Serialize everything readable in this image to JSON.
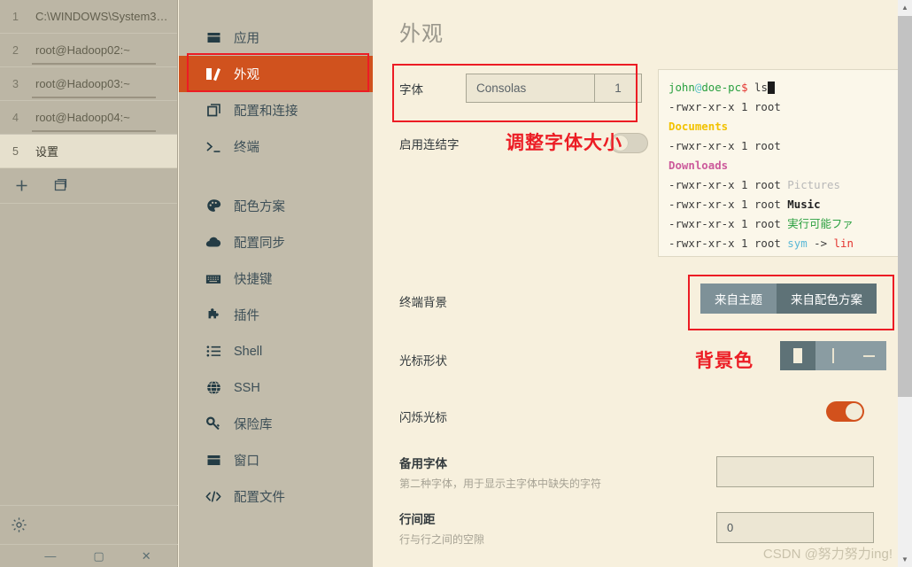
{
  "tabs": [
    {
      "num": "1",
      "label": "C:\\WINDOWS\\System3…",
      "active": false,
      "underline": false
    },
    {
      "num": "2",
      "label": "root@Hadoop02:~",
      "active": false,
      "underline": true
    },
    {
      "num": "3",
      "label": "root@Hadoop03:~",
      "active": false,
      "underline": true
    },
    {
      "num": "4",
      "label": "root@Hadoop04:~",
      "active": false,
      "underline": true
    },
    {
      "num": "5",
      "label": "设置",
      "active": true,
      "underline": false
    }
  ],
  "tab_actions": {
    "new_tab_icon": "plus-icon",
    "split_icon": "window-copy-icon"
  },
  "rail_bottom": {
    "settings_icon": "gear-icon"
  },
  "window_controls": {
    "minimize": "—",
    "maximize": "▢",
    "close": "✕"
  },
  "settings_nav": {
    "items": [
      {
        "label": "应用",
        "icon": "window-icon",
        "selected": false
      },
      {
        "label": "外观",
        "icon": "appearance-icon",
        "selected": true
      },
      {
        "label": "配置和连接",
        "icon": "profiles-icon",
        "selected": false
      },
      {
        "label": "终端",
        "icon": "terminal-prompt-icon",
        "selected": false
      },
      {
        "label": "配色方案",
        "icon": "palette-icon",
        "selected": false
      },
      {
        "label": "配置同步",
        "icon": "cloud-icon",
        "selected": false
      },
      {
        "label": "快捷键",
        "icon": "keyboard-icon",
        "selected": false
      },
      {
        "label": "插件",
        "icon": "puzzle-icon",
        "selected": false
      },
      {
        "label": "Shell",
        "icon": "list-icon",
        "selected": false
      },
      {
        "label": "SSH",
        "icon": "globe-icon",
        "selected": false
      },
      {
        "label": "保险库",
        "icon": "key-icon",
        "selected": false
      },
      {
        "label": "窗口",
        "icon": "window-icon",
        "selected": false
      },
      {
        "label": "配置文件",
        "icon": "code-icon",
        "selected": false
      }
    ]
  },
  "main": {
    "title": "外观",
    "font_row": {
      "label": "字体",
      "font_name": "Consolas",
      "font_name_placeholder": "",
      "font_size": "1",
      "font_size_placeholder": ""
    },
    "ligature_row": {
      "label": "启用连结字",
      "enabled": false
    },
    "terminal_background_row": {
      "label": "终端背景",
      "options": [
        {
          "label": "来自主题",
          "active": false
        },
        {
          "label": "来自配色方案",
          "active": true
        }
      ]
    },
    "cursor_shape_row": {
      "label": "光标形状",
      "options": [
        {
          "name": "block",
          "active": true
        },
        {
          "name": "beam",
          "active": false
        },
        {
          "name": "underline",
          "active": false
        }
      ]
    },
    "blink_cursor_row": {
      "label": "闪烁光标",
      "enabled": true
    },
    "fallback_font_row": {
      "label": "备用字体",
      "sublabel": "第二种字体，用于显示主字体中缺失的字符",
      "value": "",
      "placeholder": ""
    },
    "line_height_row": {
      "label": "行间距",
      "sublabel": "行与行之间的空隙",
      "value": "0",
      "placeholder": ""
    }
  },
  "terminal_preview": {
    "prompt": {
      "user": "john",
      "at": "@",
      "host": "doe-pc",
      "sigil": "$",
      "command": "ls"
    },
    "lines": [
      {
        "perm": "-rwxr-xr-x 1 root",
        "name": "",
        "name_class": ""
      },
      {
        "perm": "",
        "name": "Documents",
        "name_class": "tok-yellow"
      },
      {
        "perm": "-rwxr-xr-x 1 root",
        "name": "",
        "name_class": ""
      },
      {
        "perm": "",
        "name": "Downloads",
        "name_class": "tok-pink"
      },
      {
        "perm": "-rwxr-xr-x 1 root",
        "name": "Pictures",
        "name_class": "tok-gray"
      },
      {
        "perm": "-rwxr-xr-x 1 root",
        "name": "Music",
        "name_class": "tok-black"
      },
      {
        "perm": "-rwxr-xr-x 1 root",
        "name": "実行可能ファ",
        "name_class": "tok-green"
      },
      {
        "perm": "-rwxr-xr-x 1 root",
        "name": "sym -> lin",
        "name_class": "tok-cyan-red"
      }
    ],
    "symlink": {
      "src": "sym",
      "arrow": "->",
      "dst": "lin"
    }
  },
  "annotations": {
    "font_size_text": "调整字体大小",
    "background_color_text": "背景色"
  },
  "colors": {
    "accent": "#d0521e",
    "annotation": "#ec1c24",
    "panel_bg": "#f7f0dd",
    "nav_bg": "#c2bcab",
    "rail_bg": "#bcb6a5",
    "toggle_on": "#d2511c",
    "segment_active": "#5e7277",
    "segment_inactive": "#7e9198"
  },
  "scrollbar": {
    "up_arrow": "▲",
    "down_arrow": "▼"
  },
  "watermark": "CSDN @努力努力ing!"
}
